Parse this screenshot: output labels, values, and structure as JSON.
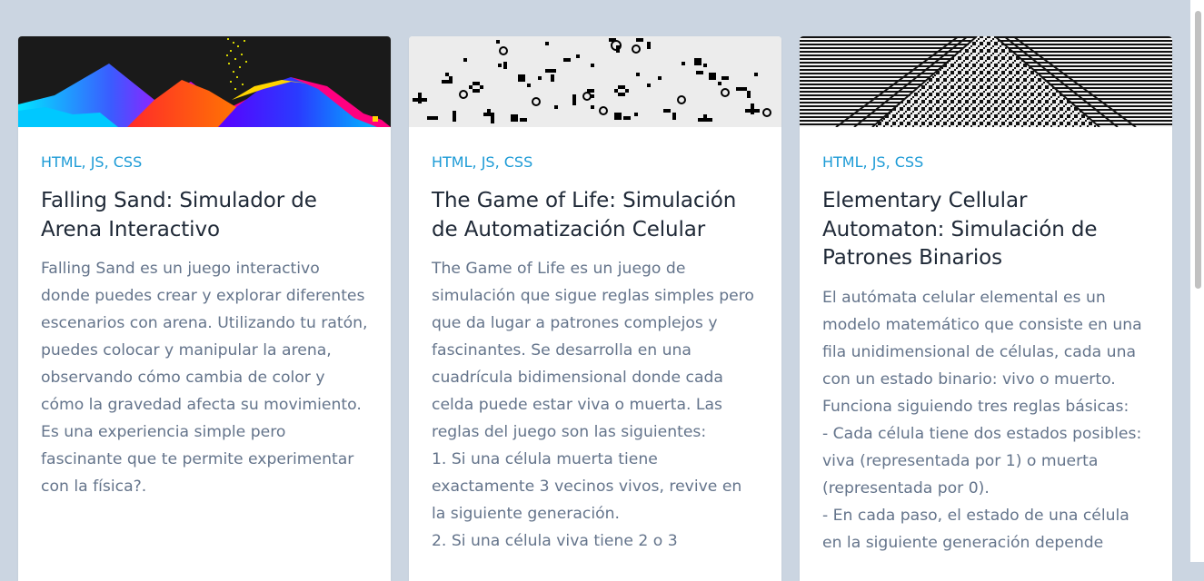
{
  "cards": [
    {
      "thumb_icon": "falling-sand-preview",
      "tags": "HTML, JS, CSS",
      "title": "Falling Sand: Simulador de Arena Interactivo",
      "description": "Falling Sand es un juego interactivo donde puedes crear y explorar diferentes escenarios con arena. Utilizando tu ratón, puedes colocar y manipular la arena, observando cómo cambia de color y cómo la gravedad afecta su movimiento. Es una experiencia simple pero fascinante que te permite experimentar con la física?."
    },
    {
      "thumb_icon": "game-of-life-preview",
      "tags": "HTML, JS, CSS",
      "title": "The Game of Life: Simulación de Automatización Celular",
      "description": "The Game of Life es un juego de simulación que sigue reglas simples pero que da lugar a patrones complejos y fascinantes. Se desarrolla en una cuadrícula bidimensional donde cada celda puede estar viva o muerta. Las reglas del juego son las siguientes:\n1. Si una célula muerta tiene exactamente 3 vecinos vivos, revive en la siguiente generación.\n2. Si una célula viva tiene 2 o 3"
    },
    {
      "thumb_icon": "cellular-automaton-preview",
      "tags": "HTML, JS, CSS",
      "title": "Elementary Cellular Automaton: Simulación de Patrones Binarios",
      "description": "El autómata celular elemental es un modelo matemático que consiste en una fila unidimensional de células, cada una con un estado binario: vivo o muerto. Funciona siguiendo tres reglas básicas:\n- Cada célula tiene dos estados posibles: viva (representada por 1) o muerta (representada por 0).\n- En cada paso, el estado de una célula en la siguiente generación depende"
    }
  ],
  "colors": {
    "background": "#cbd5e1",
    "tag": "#1d9bd6",
    "title": "#1f2937",
    "text": "#64748b"
  }
}
